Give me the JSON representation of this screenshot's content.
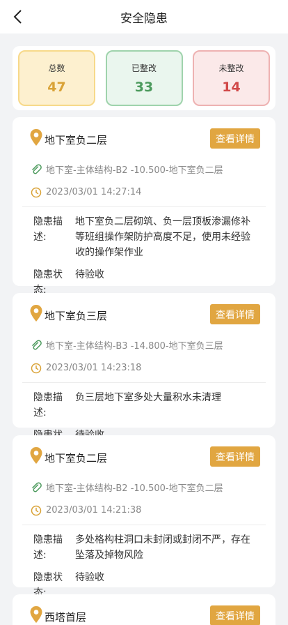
{
  "header": {
    "title": "安全隐患"
  },
  "stats": [
    {
      "label": "总数",
      "value": "47"
    },
    {
      "label": "已整改",
      "value": "33"
    },
    {
      "label": "未整改",
      "value": "14"
    }
  ],
  "detail_label": "查看详情",
  "desc_key": "隐患描述:",
  "status_key": "隐患状态:",
  "hazards": [
    {
      "location": "地下室负二层",
      "path": "地下室-主体结构-B2 -10.500-地下室负二层",
      "time": "2023/03/01 14:27:14",
      "description": "地下室负二层砌筑、负一层顶板渗漏修补等班组操作架防护高度不足，使用未经验收的操作架作业",
      "status": "待验收"
    },
    {
      "location": "地下室负三层",
      "path": "地下室-主体结构-B3 -14.800-地下室负三层",
      "time": "2023/03/01 14:23:18",
      "description": "负三层地下室多处大量积水未清理",
      "status": "待验收"
    },
    {
      "location": "地下室负二层",
      "path": "地下室-主体结构-B2 -10.500-地下室负二层",
      "time": "2023/03/01 14:21:38",
      "description": "多处格构柱洞口未封闭或封闭不严，存在坠落及掉物风险",
      "status": "待验收"
    },
    {
      "location": "西塔首层"
    }
  ]
}
